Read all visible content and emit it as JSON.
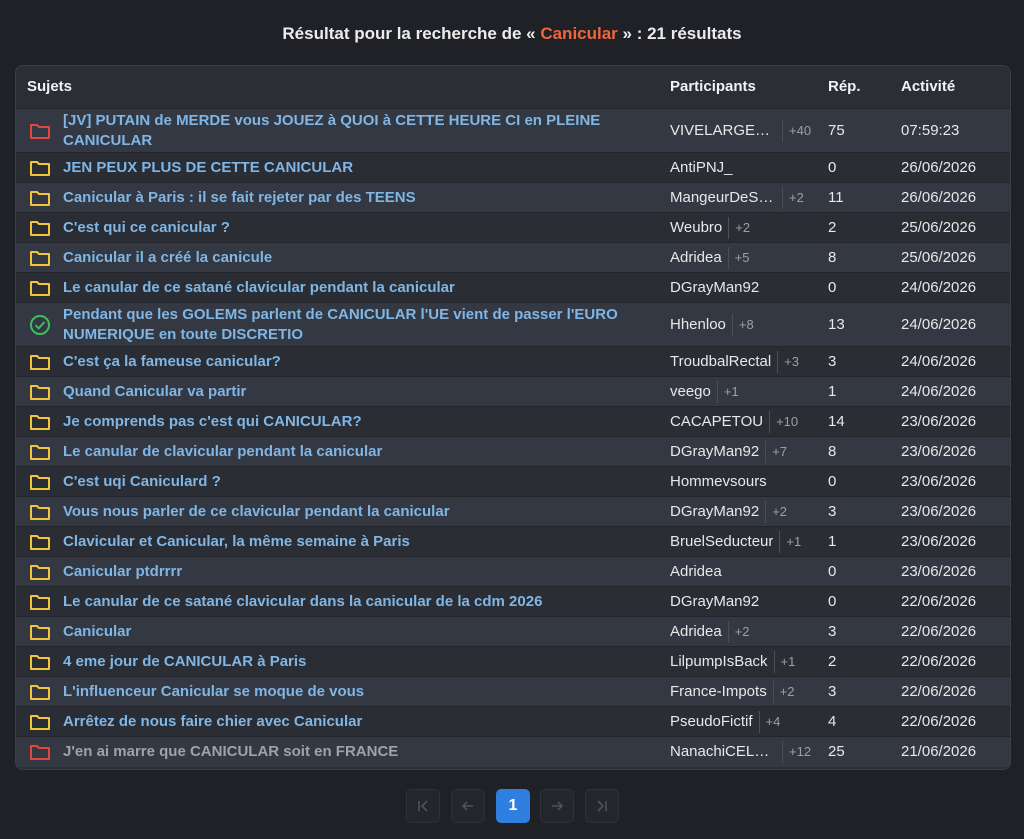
{
  "heading": {
    "prefix": "Résultat pour la recherche de « ",
    "term": "Canicular",
    "suffix": " » : 21 résultats"
  },
  "columns": {
    "subject": "Sujets",
    "participants": "Participants",
    "replies": "Rép.",
    "activity": "Activité"
  },
  "colors": {
    "folder_yellow": "#f3c63a",
    "folder_red": "#e2473f",
    "check_green": "#3cc05a",
    "link_blue": "#7fb6e6",
    "term_orange": "#f0653a",
    "pager_active": "#2f7fe0"
  },
  "topics": [
    {
      "icon": "folder-red",
      "subject": "[JV] PUTAIN de MERDE vous JOUEZ à QUOI à CETTE HEURE CI en PLEINE CANICULAR",
      "author": "VIVELARGENTFACILE",
      "more": "+40",
      "replies": "75",
      "activity": "07:59:23"
    },
    {
      "icon": "folder-yellow",
      "subject": "JEN PEUX PLUS DE CETTE CANICULAR",
      "author": "AntiPNJ_",
      "more": "",
      "replies": "0",
      "activity": "26/06/2026"
    },
    {
      "icon": "folder-yellow",
      "subject": "Canicular à Paris : il se fait rejeter par des TEENS",
      "author": "MangeurDeSnickers",
      "more": "+2",
      "replies": "11",
      "activity": "26/06/2026"
    },
    {
      "icon": "folder-yellow",
      "subject": "C'est qui ce canicular ?",
      "author": "Weubro",
      "more": "+2",
      "replies": "2",
      "activity": "25/06/2026"
    },
    {
      "icon": "folder-yellow",
      "subject": "Canicular il a créé la canicule",
      "author": "Adridea",
      "more": "+5",
      "replies": "8",
      "activity": "25/06/2026"
    },
    {
      "icon": "folder-yellow",
      "subject": "Le canular de ce satané clavicular pendant la canicular",
      "author": "DGrayMan92",
      "more": "",
      "replies": "0",
      "activity": "24/06/2026"
    },
    {
      "icon": "check-green",
      "subject": "Pendant que les GOLEMS parlent de CANICULAR l'UE vient de passer l'EURO NUMERIQUE en toute DISCRETIO",
      "author": "Hhenloo",
      "more": "+8",
      "replies": "13",
      "activity": "24/06/2026"
    },
    {
      "icon": "folder-yellow",
      "subject": "C'est ça la fameuse canicular?",
      "author": "TroudbalRectal",
      "more": "+3",
      "replies": "3",
      "activity": "24/06/2026"
    },
    {
      "icon": "folder-yellow",
      "subject": "Quand Canicular va partir",
      "author": "veego",
      "more": "+1",
      "replies": "1",
      "activity": "24/06/2026"
    },
    {
      "icon": "folder-yellow",
      "subject": "Je comprends pas c'est qui CANICULAR?",
      "author": "CACAPETOU",
      "more": "+10",
      "replies": "14",
      "activity": "23/06/2026"
    },
    {
      "icon": "folder-yellow",
      "subject": "Le canular de clavicular pendant la canicular",
      "author": "DGrayMan92",
      "more": "+7",
      "replies": "8",
      "activity": "23/06/2026"
    },
    {
      "icon": "folder-yellow",
      "subject": "C'est uqi Caniculard ?",
      "author": "Hommevsours",
      "more": "",
      "replies": "0",
      "activity": "23/06/2026"
    },
    {
      "icon": "folder-yellow",
      "subject": "Vous nous parler de ce clavicular pendant la canicular",
      "author": "DGrayMan92",
      "more": "+2",
      "replies": "3",
      "activity": "23/06/2026"
    },
    {
      "icon": "folder-yellow",
      "subject": "Clavicular et Canicular, la même semaine à Paris",
      "author": "BruelSeducteur",
      "more": "+1",
      "replies": "1",
      "activity": "23/06/2026"
    },
    {
      "icon": "folder-yellow",
      "subject": "Canicular ptdrrrr",
      "author": "Adridea",
      "more": "",
      "replies": "0",
      "activity": "23/06/2026"
    },
    {
      "icon": "folder-yellow",
      "subject": "Le canular de ce satané clavicular dans la canicular de la cdm 2026",
      "author": "DGrayMan92",
      "more": "",
      "replies": "0",
      "activity": "22/06/2026"
    },
    {
      "icon": "folder-yellow",
      "subject": "Canicular",
      "author": "Adridea",
      "more": "+2",
      "replies": "3",
      "activity": "22/06/2026"
    },
    {
      "icon": "folder-yellow",
      "subject": "4 eme jour de CANICULAR à Paris",
      "author": "LilpumpIsBack",
      "more": "+1",
      "replies": "2",
      "activity": "22/06/2026"
    },
    {
      "icon": "folder-yellow",
      "subject": "L'influenceur Canicular se moque de vous",
      "author": "France-Impots",
      "more": "+2",
      "replies": "3",
      "activity": "22/06/2026"
    },
    {
      "icon": "folder-yellow",
      "subject": "Arrêtez de nous faire chier avec Canicular",
      "author": "PseudoFictif",
      "more": "+4",
      "replies": "4",
      "activity": "22/06/2026"
    },
    {
      "icon": "folder-red",
      "subject": "J'en ai marre que CANICULAR soit en FRANCE",
      "author": "NanachiCELESTE",
      "more": "+12",
      "replies": "25",
      "activity": "21/06/2026",
      "dim": true
    }
  ],
  "pagination": {
    "first_icon": "first-page-icon",
    "prev_icon": "prev-page-icon",
    "current": "1",
    "next_icon": "next-page-icon",
    "last_icon": "last-page-icon"
  }
}
